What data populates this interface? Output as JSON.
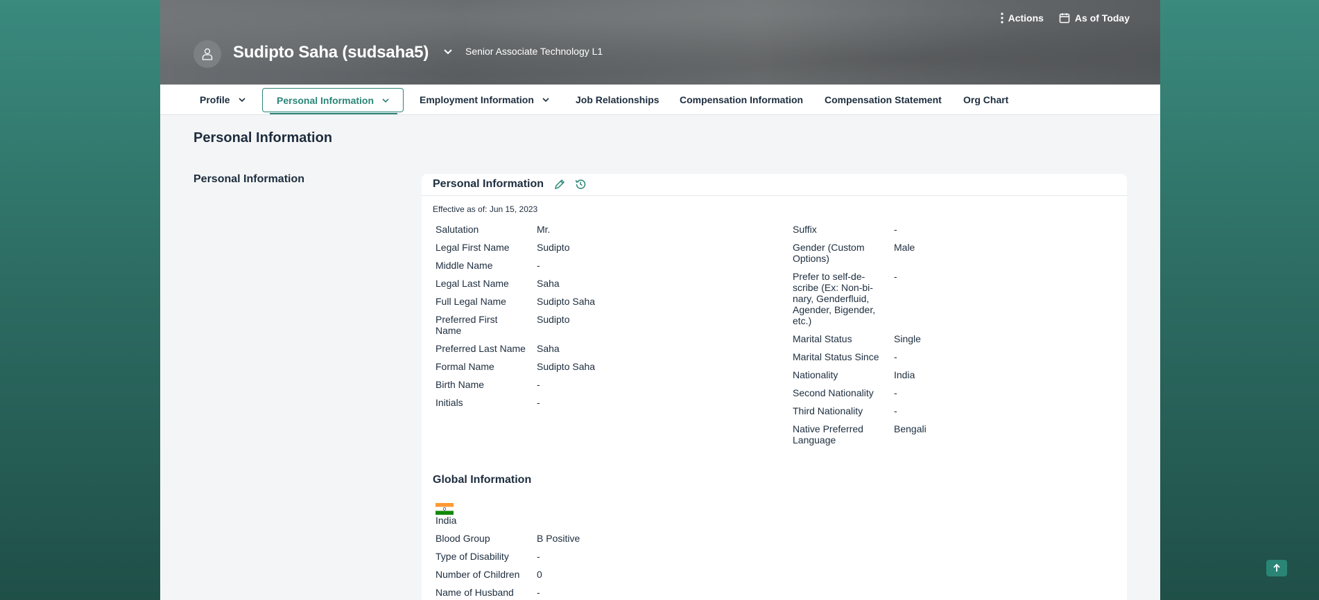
{
  "header": {
    "employee_name": "Sudipto Saha (sudsaha5)",
    "job_title": "Senior Associate Technology L1",
    "actions_label": "Actions",
    "as_of_label": "As of Today"
  },
  "tabs": [
    {
      "label": "Profile",
      "has_menu": true
    },
    {
      "label": "Personal Information",
      "has_menu": true,
      "active": true
    },
    {
      "label": "Employment Information",
      "has_menu": true
    },
    {
      "label": "Job Relationships",
      "has_menu": false
    },
    {
      "label": "Compensation Information",
      "has_menu": false
    },
    {
      "label": "Compensation Statement",
      "has_menu": false
    },
    {
      "label": "Org Chart",
      "has_menu": false
    }
  ],
  "page": {
    "title": "Personal Information",
    "side_link": "Personal Information"
  },
  "card": {
    "title": "Personal Information",
    "edit_icon": "pencil-icon",
    "history_icon": "history-icon",
    "effective": "Effective as of: Jun 15, 2023",
    "left_fields": [
      {
        "label": "Salutation",
        "value": "Mr."
      },
      {
        "label": "Legal First Name",
        "value": "Sudipto"
      },
      {
        "label": "Middle Name",
        "value": "-"
      },
      {
        "label": "Legal Last Name",
        "value": "Saha"
      },
      {
        "label": "Full Legal Name",
        "value": "Sudipto Saha"
      },
      {
        "label": "Preferred First Name",
        "value": "Sudipto"
      },
      {
        "label": "Preferred Last Name",
        "value": "Saha"
      },
      {
        "label": "Formal Name",
        "value": "Sudipto Saha"
      },
      {
        "label": "Birth Name",
        "value": "-"
      },
      {
        "label": "Initials",
        "value": "-"
      }
    ],
    "right_fields": [
      {
        "label": "Suffix",
        "value": "-"
      },
      {
        "label": "Gender (Custom Options)",
        "value": "Male"
      },
      {
        "label": "Prefer to self-de-scribe (Ex: Non-bi-nary, Genderfluid, Agender, Bigender, etc.)",
        "value": "-"
      },
      {
        "label": "Marital Status",
        "value": "Single"
      },
      {
        "label": "Marital Status Since",
        "value": "-"
      },
      {
        "label": "Nationality",
        "value": "India"
      },
      {
        "label": "Second Nationality",
        "value": "-"
      },
      {
        "label": "Third Nationality",
        "value": "-"
      },
      {
        "label": "Native Preferred Language",
        "value": "Bengali"
      }
    ]
  },
  "global": {
    "title": "Global Information",
    "country": "India",
    "flag_colors": [
      "#ff9933",
      "#ffffff",
      "#138808"
    ],
    "fields": [
      {
        "label": "Blood Group",
        "value": "B Positive"
      },
      {
        "label": "Type of Disability",
        "value": "-"
      },
      {
        "label": "Number of Children",
        "value": "0"
      },
      {
        "label": "Name of Husband",
        "value": "-"
      }
    ]
  },
  "colors": {
    "accent": "#2a8577",
    "text": "#1d2d3e"
  }
}
